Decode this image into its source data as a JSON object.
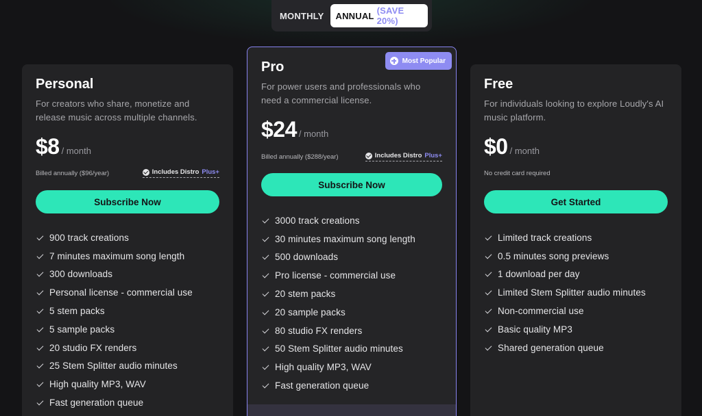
{
  "toggle": {
    "monthly_label": "MONTHLY",
    "annual_label": "ANNUAL",
    "save_label": "(SAVE 20%)"
  },
  "colors": {
    "accent": "#2de6b8",
    "purple": "#8e8cf2",
    "background": "#141416",
    "card": "#232325"
  },
  "plans": {
    "personal": {
      "title": "Personal",
      "description": "For creators who share, monetize and release music across multiple channels.",
      "price": "$8",
      "period": "/ month",
      "billing": "Billed annually ($96/year)",
      "includes_label": "Includes Distro",
      "includes_plus": "Plus+",
      "cta": "Subscribe Now",
      "features": [
        "900 track creations",
        "7 minutes maximum song length",
        "300 downloads",
        "Personal license - commercial use",
        "5 stem packs",
        "5 sample packs",
        "20 studio FX renders",
        "25 Stem Splitter audio minutes",
        "High quality MP3, WAV",
        "Fast generation queue"
      ]
    },
    "pro": {
      "badge": "Most Popular",
      "title": "Pro",
      "description": "For power users and professionals who need a commercial license.",
      "price": "$24",
      "period": "/ month",
      "billing": "Billed annually ($288/year)",
      "includes_label": "Includes Distro",
      "includes_plus": "Plus+",
      "cta": "Subscribe Now",
      "features": [
        "3000 track creations",
        "30 minutes maximum song length",
        "500 downloads",
        "Pro license - commercial use",
        "20 stem packs",
        "20 sample packs",
        "80 studio FX renders",
        "50 Stem Splitter audio minutes",
        "High quality MP3, WAV",
        "Fast generation queue"
      ]
    },
    "free": {
      "title": "Free",
      "description": "For individuals looking to explore Loudly's AI music platform.",
      "price": "$0",
      "period": "/ month",
      "billing": "No credit card required",
      "cta": "Get Started",
      "features": [
        "Limited track creations",
        "0.5 minutes song previews",
        "1 download per day",
        "Limited Stem Splitter audio minutes",
        "Non-commercial use",
        "Basic quality MP3",
        "Shared generation queue"
      ]
    }
  }
}
